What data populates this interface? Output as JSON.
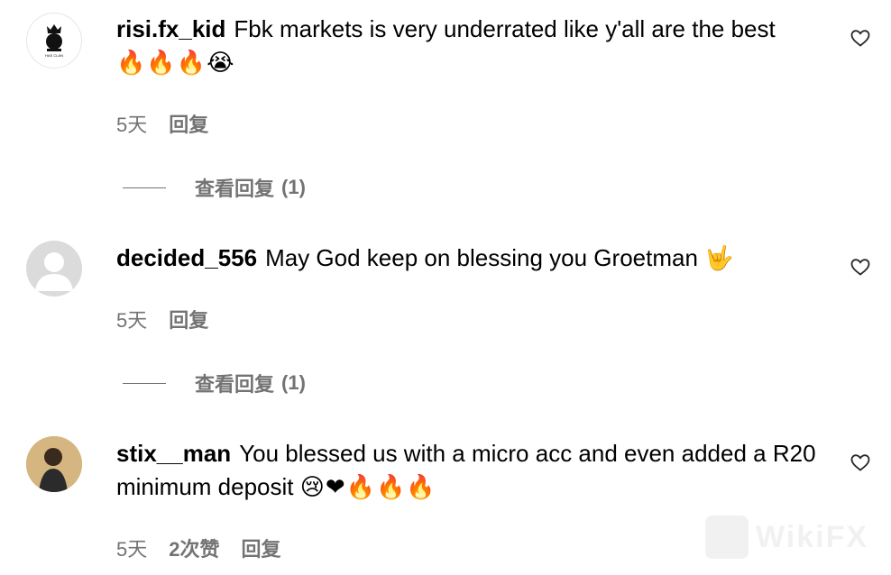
{
  "comments": [
    {
      "username": "risi.fx_kid",
      "text": "Fbk markets is very underrated like y'all are the best",
      "emoji": "🔥🔥🔥😭",
      "time": "5天",
      "reply_label": "回复",
      "view_replies_label": "查看回复",
      "reply_count": "(1)"
    },
    {
      "username": "decided_556",
      "text": "May God keep on blessing you Groetman",
      "emoji": "🤟",
      "time": "5天",
      "reply_label": "回复",
      "view_replies_label": "查看回复",
      "reply_count": "(1)"
    },
    {
      "username": "stix__man",
      "text": "You blessed us with a micro acc and even added a R20 minimum deposit",
      "emoji": "😢❤🔥🔥🔥",
      "time": "5天",
      "likes_label": "2次赞",
      "reply_label": "回复"
    }
  ],
  "watermark": "WikiFX",
  "colors": {
    "meta": "#737373",
    "text": "#000000",
    "background": "#ffffff"
  },
  "icons": {
    "like": "heart-outline-icon"
  }
}
